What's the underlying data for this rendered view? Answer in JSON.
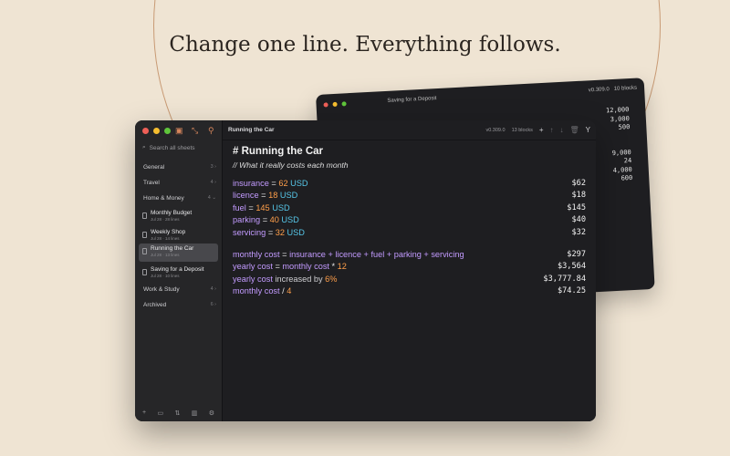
{
  "headline": "Change one line. Everything follows.",
  "back_window": {
    "title": "Saving for a Deposit",
    "meta_version": "v0.309.0",
    "meta_blocks": "10 blocks",
    "results_top": [
      "12,000",
      "3,000",
      "500"
    ],
    "results_bottom": [
      "9,000",
      "24",
      "4,000",
      "600"
    ]
  },
  "sidebar": {
    "search_placeholder": "Search all sheets",
    "folders": {
      "general": {
        "label": "General",
        "count": "3"
      },
      "travel": {
        "label": "Travel",
        "count": "4"
      },
      "home_money": {
        "label": "Home & Money",
        "count": "4"
      },
      "work_study": {
        "label": "Work & Study",
        "count": "4"
      },
      "archived": {
        "label": "Archived",
        "count": "6"
      }
    },
    "sheets": [
      {
        "title": "Monthly Budget",
        "meta": "Jul 28 · 28 lines"
      },
      {
        "title": "Weekly Shop",
        "meta": "Jul 28 · 14 lines"
      },
      {
        "title": "Running the Car",
        "meta": "Jul 28 · 13 lines"
      },
      {
        "title": "Saving for a Deposit",
        "meta": "Jul 28 · 10 lines"
      }
    ]
  },
  "toolbar": {
    "title": "Running the Car",
    "version": "v0.309.0",
    "blocks": "13 blocks"
  },
  "editor": {
    "heading": "# Running the Car",
    "comment": "// What it really costs each month",
    "lines": {
      "l1": {
        "var": "insurance",
        "eq": " = ",
        "num": "62",
        "unit": " USD",
        "result": "$62"
      },
      "l2": {
        "var": "licence",
        "eq": " = ",
        "num": "18",
        "unit": " USD",
        "result": "$18"
      },
      "l3": {
        "var": "fuel",
        "eq": " = ",
        "num": "145",
        "unit": " USD",
        "result": "$145"
      },
      "l4": {
        "var": "parking",
        "eq": " = ",
        "num": "40",
        "unit": " USD",
        "result": "$40"
      },
      "l5": {
        "var": "servicing",
        "eq": " = ",
        "num": "32",
        "unit": " USD",
        "result": "$32"
      },
      "l6": {
        "var": "monthly cost",
        "eq": " = ",
        "expr": "insurance + licence + fuel + parking + servicing",
        "result": "$297"
      },
      "l7": {
        "var": "yearly cost",
        "eq": " = ",
        "ref": "monthly cost",
        "op": " * ",
        "num": "12",
        "result": "$3,564"
      },
      "l8": {
        "var": "yearly cost",
        "kw": " increased by ",
        "num": "6%",
        "result": "$3,777.84"
      },
      "l9": {
        "var": "monthly cost",
        "op": " / ",
        "num": "4",
        "result": "$74.25"
      }
    }
  },
  "colors": {
    "variable": "#c39bff",
    "number": "#ff9f4a",
    "unit": "#56c6e8",
    "background": "#efe4d3"
  }
}
